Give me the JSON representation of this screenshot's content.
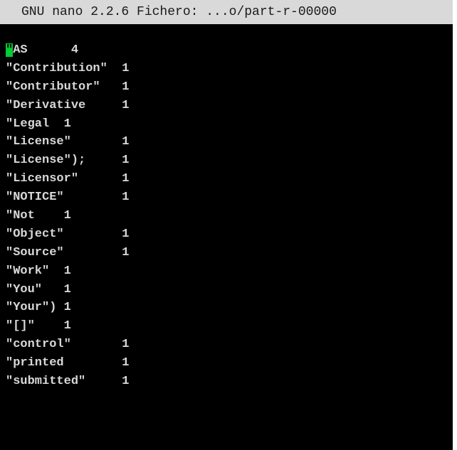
{
  "app": {
    "title": "GNU nano 2.2.6 Fichero: ...o/part-r-00000"
  },
  "colors": {
    "background": "#000000",
    "text": "#d8d8d8",
    "titlebar_bg": "#d9d9d9",
    "titlebar_text": "#1a1a1a",
    "cursor": "#00cc33"
  },
  "cursor": {
    "char": "\""
  },
  "lines": [
    {
      "word": "AS",
      "sep": "      ",
      "count": "4"
    },
    {
      "word": "\"Contribution\"",
      "sep": "  ",
      "count": "1"
    },
    {
      "word": "\"Contributor\"",
      "sep": "   ",
      "count": "1"
    },
    {
      "word": "\"Derivative",
      "sep": "     ",
      "count": "1"
    },
    {
      "word": "\"Legal",
      "sep": "  ",
      "count": "1"
    },
    {
      "word": "\"License\"",
      "sep": "       ",
      "count": "1"
    },
    {
      "word": "\"License\");",
      "sep": "     ",
      "count": "1"
    },
    {
      "word": "\"Licensor\"",
      "sep": "      ",
      "count": "1"
    },
    {
      "word": "\"NOTICE\"",
      "sep": "        ",
      "count": "1"
    },
    {
      "word": "\"Not",
      "sep": "    ",
      "count": "1"
    },
    {
      "word": "\"Object\"",
      "sep": "        ",
      "count": "1"
    },
    {
      "word": "\"Source\"",
      "sep": "        ",
      "count": "1"
    },
    {
      "word": "\"Work\"",
      "sep": "  ",
      "count": "1"
    },
    {
      "word": "\"You\"",
      "sep": "   ",
      "count": "1"
    },
    {
      "word": "\"Your\")",
      "sep": " ",
      "count": "1"
    },
    {
      "word": "\"[]\"",
      "sep": "    ",
      "count": "1"
    },
    {
      "word": "\"control\"",
      "sep": "       ",
      "count": "1"
    },
    {
      "word": "\"printed",
      "sep": "        ",
      "count": "1"
    },
    {
      "word": "\"submitted\"",
      "sep": "     ",
      "count": "1"
    }
  ]
}
